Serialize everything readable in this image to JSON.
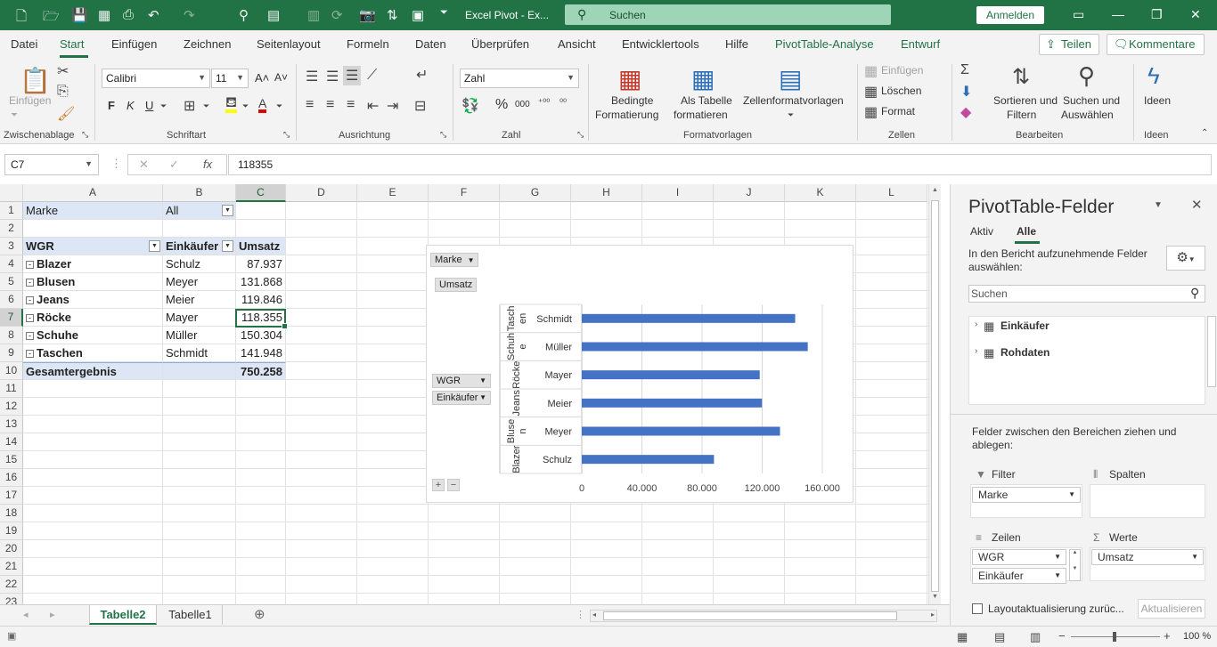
{
  "titlebar": {
    "title": "Excel Pivot  -  Ex...",
    "search_placeholder": "Suchen",
    "signin": "Anmelden"
  },
  "tabs": [
    "Datei",
    "Start",
    "Einfügen",
    "Zeichnen",
    "Seitenlayout",
    "Formeln",
    "Daten",
    "Überprüfen",
    "Ansicht",
    "Entwicklertools",
    "Hilfe",
    "PivotTable-Analyse",
    "Entwurf"
  ],
  "share_label": "Teilen",
  "comments_label": "Kommentare",
  "ribbon": {
    "clipboard": {
      "paste": "Einfügen",
      "group": "Zwischenablage"
    },
    "font": {
      "name": "Calibri",
      "size": "11",
      "bold": "F",
      "italic": "K",
      "underline": "U",
      "group": "Schriftart"
    },
    "alignment": {
      "group": "Ausrichtung"
    },
    "number": {
      "format": "Zahl",
      "group": "Zahl"
    },
    "styles": {
      "conditional": "Bedingte",
      "conditional2": "Formatierung",
      "astable": "Als Tabelle",
      "astable2": "formatieren",
      "cellstyles": "Zellenformatvorlagen",
      "group": "Formatvorlagen"
    },
    "cells": {
      "insert": "Einfügen",
      "delete": "Löschen",
      "format": "Format",
      "group": "Zellen"
    },
    "editing": {
      "sort": "Sortieren und",
      "sort2": "Filtern",
      "find": "Suchen und",
      "find2": "Auswählen",
      "group": "Bearbeiten"
    },
    "ideas": {
      "label": "Ideen",
      "group": "Ideen"
    }
  },
  "formula_bar": {
    "name_box": "C7",
    "formula": "118355"
  },
  "columns": [
    "A",
    "B",
    "C",
    "D",
    "E",
    "F",
    "G",
    "H",
    "I",
    "J",
    "K",
    "L"
  ],
  "rows": [
    "1",
    "2",
    "3",
    "4",
    "5",
    "6",
    "7",
    "8",
    "9",
    "10",
    "11",
    "12",
    "13",
    "14",
    "15",
    "16",
    "17",
    "18",
    "19",
    "20",
    "21",
    "22",
    "23"
  ],
  "pivot": {
    "filter_label": "Marke",
    "filter_value": "All",
    "headers": [
      "WGR",
      "Einkäufer",
      "Umsatz"
    ],
    "data": [
      {
        "wgr": "Blazer",
        "buyer": "Schulz",
        "value": "87.937"
      },
      {
        "wgr": "Blusen",
        "buyer": "Meyer",
        "value": "131.868"
      },
      {
        "wgr": "Jeans",
        "buyer": "Meier",
        "value": "119.846"
      },
      {
        "wgr": "Röcke",
        "buyer": "Mayer",
        "value": "118.355"
      },
      {
        "wgr": "Schuhe",
        "buyer": "Müller",
        "value": "150.304"
      },
      {
        "wgr": "Taschen",
        "buyer": "Schmidt",
        "value": "141.948"
      }
    ],
    "total_label": "Gesamtergebnis",
    "total_value": "750.258"
  },
  "chart_buttons": {
    "marke": "Marke",
    "umsatz": "Umsatz",
    "wgr": "WGR",
    "einkaeufer": "Einkäufer"
  },
  "chart_data": {
    "type": "bar",
    "orientation": "horizontal",
    "categories_outer": [
      "Blazer",
      "Bluse\nn",
      "Jeans",
      "Röcke",
      "Schuh\ne",
      "Tasch\nen"
    ],
    "categories": [
      "Schulz",
      "Meyer",
      "Meier",
      "Mayer",
      "Müller",
      "Schmidt"
    ],
    "series": [
      {
        "values": [
          87937,
          131868,
          119846,
          118355,
          150304,
          141948
        ]
      }
    ],
    "xlim": [
      0,
      160000
    ],
    "xticks": [
      "0",
      "40.000",
      "80.000",
      "120.000",
      "160.000"
    ],
    "color": "#4472c4"
  },
  "sheets": [
    "Tabelle2",
    "Tabelle1"
  ],
  "pane": {
    "title": "PivotTable-Felder",
    "tab_active": "Aktiv",
    "tab_all": "Alle",
    "hint": "In den Bericht aufzunehmende Felder auswählen:",
    "search_placeholder": "Suchen",
    "tables": [
      "Einkäufer",
      "Rohdaten"
    ],
    "drag_hint": "Felder zwischen den Bereichen ziehen und ablegen:",
    "filter_title": "Filter",
    "columns_title": "Spalten",
    "rows_title": "Zeilen",
    "values_title": "Werte",
    "filter_item": "Marke",
    "row_items": [
      "WGR",
      "Einkäufer"
    ],
    "value_item": "Umsatz",
    "defer_label": "Layoutaktualisierung zurüc...",
    "update_label": "Aktualisieren"
  },
  "status": {
    "zoom": "100 %"
  }
}
